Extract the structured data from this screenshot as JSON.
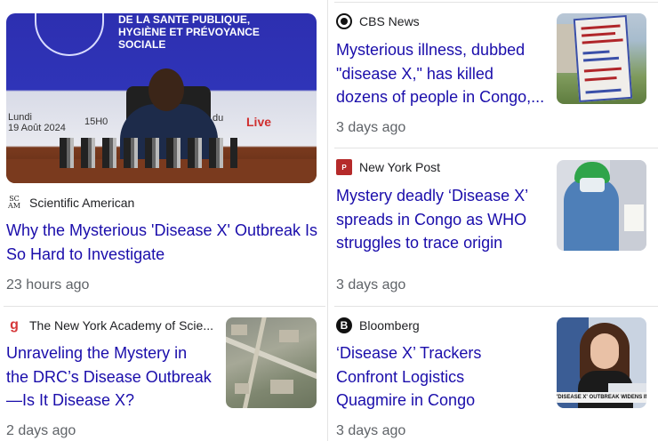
{
  "articles": [
    {
      "source": "Scientific American",
      "source_icon": "scientific-american-logo",
      "headline_lines": [
        "Why the Mysterious 'Disease X' Outbreak Is",
        "So Hard to Investigate"
      ],
      "time": "23 hours ago",
      "image": {
        "description_icon": "press-conference-image",
        "banner_lines": [
          "DE LA SANTE PUBLIQUE,",
          "HYGIÈNE ET PRÉVOYANCE",
          "SOCIALE"
        ],
        "date_lines": [
          "Lundi",
          "19 Août 2024"
        ],
        "time_text": "15H0",
        "du_text": "du",
        "live_text": "Live"
      }
    },
    {
      "source": "CBS News",
      "source_icon": "cbs-eye-logo",
      "headline_lines": [
        "Mysterious illness, dubbed",
        "\"disease X,\" has killed",
        "dozens of people in Congo,..."
      ],
      "time": "3 days ago"
    },
    {
      "source": "New York Post",
      "source_icon": "new-york-post-logo",
      "headline_lines": [
        "Mystery deadly ‘Disease X’",
        "spreads in Congo as WHO",
        "struggles to trace origin"
      ],
      "time": "3 days ago"
    },
    {
      "source": "The New York Academy of Scie...",
      "source_icon": "nyas-logo",
      "headline_lines": [
        "Unraveling the Mystery in",
        "the DRC’s Disease Outbreak",
        "—Is It Disease X?"
      ],
      "time": "2 days ago"
    },
    {
      "source": "Bloomberg",
      "source_icon": "bloomberg-logo",
      "headline_lines": [
        "‘Disease X’ Trackers",
        "Confront Logistics",
        "Quagmire in Congo"
      ],
      "time": "3 days ago",
      "image": {
        "strap_text": "'DISEASE X' OUTBREAK WIDENS IN"
      }
    }
  ],
  "colors": {
    "headline": "#1a0dab",
    "meta": "#5f6368",
    "divider": "#e3e3e3"
  }
}
